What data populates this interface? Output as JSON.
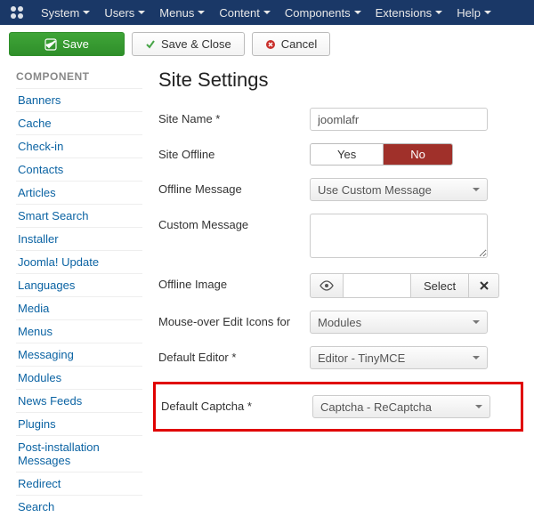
{
  "topmenu": [
    "System",
    "Users",
    "Menus",
    "Content",
    "Components",
    "Extensions",
    "Help"
  ],
  "toolbar": {
    "save": "Save",
    "saveclose": "Save & Close",
    "cancel": "Cancel"
  },
  "sidebar": {
    "heading": "COMPONENT",
    "items": [
      "Banners",
      "Cache",
      "Check-in",
      "Contacts",
      "Articles",
      "Smart Search",
      "Installer",
      "Joomla! Update",
      "Languages",
      "Media",
      "Menus",
      "Messaging",
      "Modules",
      "News Feeds",
      "Plugins",
      "Post-installation Messages",
      "Redirect",
      "Search"
    ]
  },
  "page": {
    "title": "Site Settings"
  },
  "form": {
    "sitename": {
      "label": "Site Name *",
      "value": "joomlafr"
    },
    "siteoffline": {
      "label": "Site Offline",
      "yes": "Yes",
      "no": "No",
      "active": "no"
    },
    "offlinemsg": {
      "label": "Offline Message",
      "value": "Use Custom Message"
    },
    "custommsg": {
      "label": "Custom Message"
    },
    "offlineimg": {
      "label": "Offline Image",
      "select": "Select"
    },
    "mouseover": {
      "label": "Mouse-over Edit Icons for",
      "value": "Modules"
    },
    "editor": {
      "label": "Default Editor *",
      "value": "Editor - TinyMCE"
    },
    "captcha": {
      "label": "Default Captcha *",
      "value": "Captcha - ReCaptcha"
    }
  }
}
